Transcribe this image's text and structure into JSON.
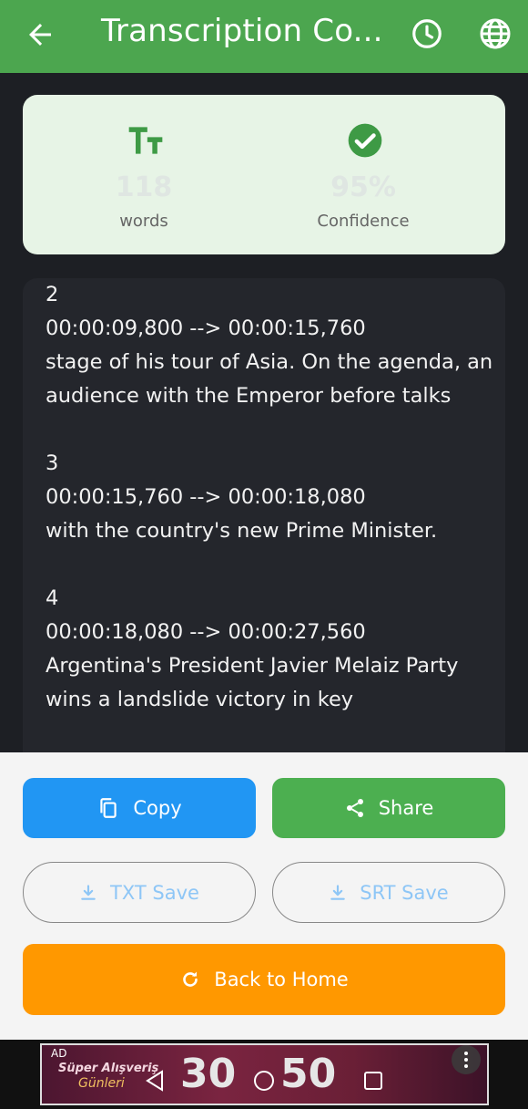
{
  "appbar": {
    "title": "Transcription Co...",
    "icons": {
      "back": "arrow-left-icon",
      "history": "clock-icon",
      "language": "globe-icon"
    }
  },
  "stats": {
    "words": {
      "value": "118",
      "label": "words",
      "icon": "text-size-icon"
    },
    "confidence": {
      "value": "95%",
      "label": "Confidence",
      "icon": "check-circle-icon"
    }
  },
  "transcript": {
    "text": "2\n00:00:09,800 --> 00:00:15,760\nstage of his tour of Asia. On the agenda, an audience with the Emperor before talks\n\n3\n00:00:15,760 --> 00:00:18,080\nwith the country's new Prime Minister.\n\n4\n00:00:18,080 --> 00:00:27,560\nArgentina's President Javier Melaiz Party wins a landslide victory in key"
  },
  "actions": {
    "copy_label": "Copy",
    "share_label": "Share",
    "txt_label": "TXT Save",
    "srt_label": "SRT Save",
    "home_label": "Back to Home"
  },
  "ad": {
    "tag": "AD",
    "line1": "Süper Alışveriş",
    "line2": "Günleri",
    "num1": "30",
    "num2": "50"
  },
  "colors": {
    "appbar": "#4ca64f",
    "copy": "#2196f3",
    "share": "#4caf50",
    "home": "#ff9800"
  }
}
